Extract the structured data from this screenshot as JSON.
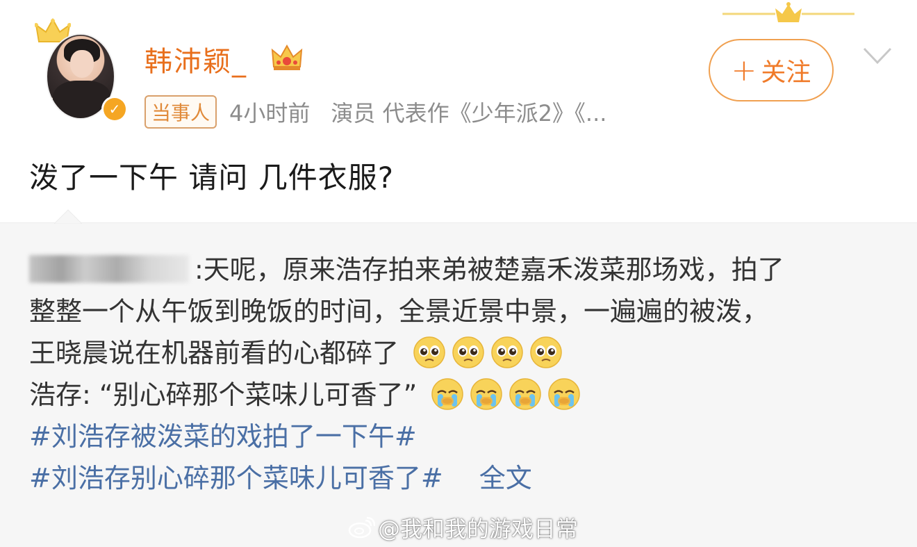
{
  "post": {
    "username": "韩沛颖_",
    "tag": "当事人",
    "time": "4小时前",
    "bio": "演员 代表作《少年派2》《...",
    "follow_label": "关注",
    "follow_plus": "+",
    "text": "泼了一下午 请问 几件衣服?"
  },
  "repost": {
    "line1_text": ":天呢，原来浩存拍来弟被楚嘉禾泼菜那场戏，拍了",
    "line2_text": "整整一个从午饭到晚饭的时间，全景近景中景，一遍遍的被泼，",
    "line3_text": "王晓晨说在机器前看的心都碎了",
    "line4_text": "浩存: “别心碎那个菜味儿可香了”",
    "hashtag1": "#刘浩存被泼菜的戏拍了一下午#",
    "hashtag2": "#刘浩存别心碎那个菜味儿可香了#",
    "full_text_link": "全文"
  },
  "watermark": "@我和我的游戏日常",
  "colors": {
    "username": "#e86f1c",
    "follow": "#f07b2a",
    "hashtag": "#4a6fa5",
    "repost_bg": "#f6f6f6"
  },
  "icons": {
    "crown": "crown-icon",
    "verified": "verified-badge-icon",
    "chevron": "chevron-down-icon",
    "emoji_pleading": "pleading-face-emoji",
    "emoji_crying": "crying-face-emoji",
    "weibo": "weibo-logo-icon"
  }
}
